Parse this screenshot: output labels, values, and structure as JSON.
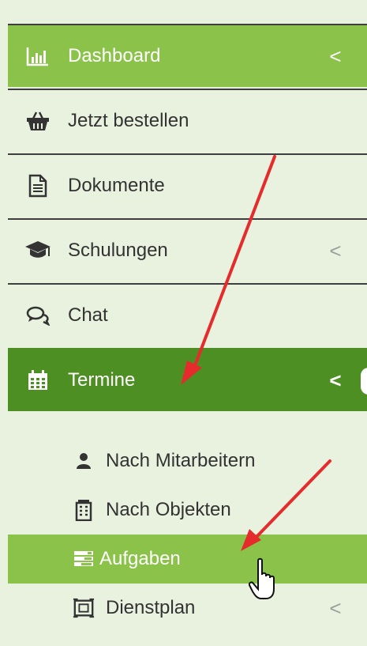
{
  "sidebar": {
    "items": [
      {
        "label": "Dashboard",
        "icon": "bar-chart-icon",
        "has_chevron": true,
        "chevron": "<"
      },
      {
        "label": "Jetzt bestellen",
        "icon": "basket-icon",
        "has_chevron": false
      },
      {
        "label": "Dokumente",
        "icon": "document-icon",
        "has_chevron": false
      },
      {
        "label": "Schulungen",
        "icon": "graduation-cap-icon",
        "has_chevron": true,
        "chevron": "<"
      },
      {
        "label": "Chat",
        "icon": "chat-icon",
        "has_chevron": false
      },
      {
        "label": "Termine",
        "icon": "calendar-icon",
        "has_chevron": true,
        "chevron": "<"
      }
    ],
    "submenu": [
      {
        "label": "Nach Mitarbeitern",
        "icon": "user-icon"
      },
      {
        "label": "Nach Objekten",
        "icon": "building-icon"
      },
      {
        "label": "Aufgaben",
        "icon": "tasks-icon"
      },
      {
        "label": "Dienstplan",
        "icon": "schedule-icon",
        "has_chevron": true,
        "chevron": "<"
      }
    ]
  },
  "colors": {
    "background": "#e9f1df",
    "active_light": "#8bc34a",
    "active_dark": "#4e8f24",
    "annotation_arrow": "#e52b2b"
  }
}
